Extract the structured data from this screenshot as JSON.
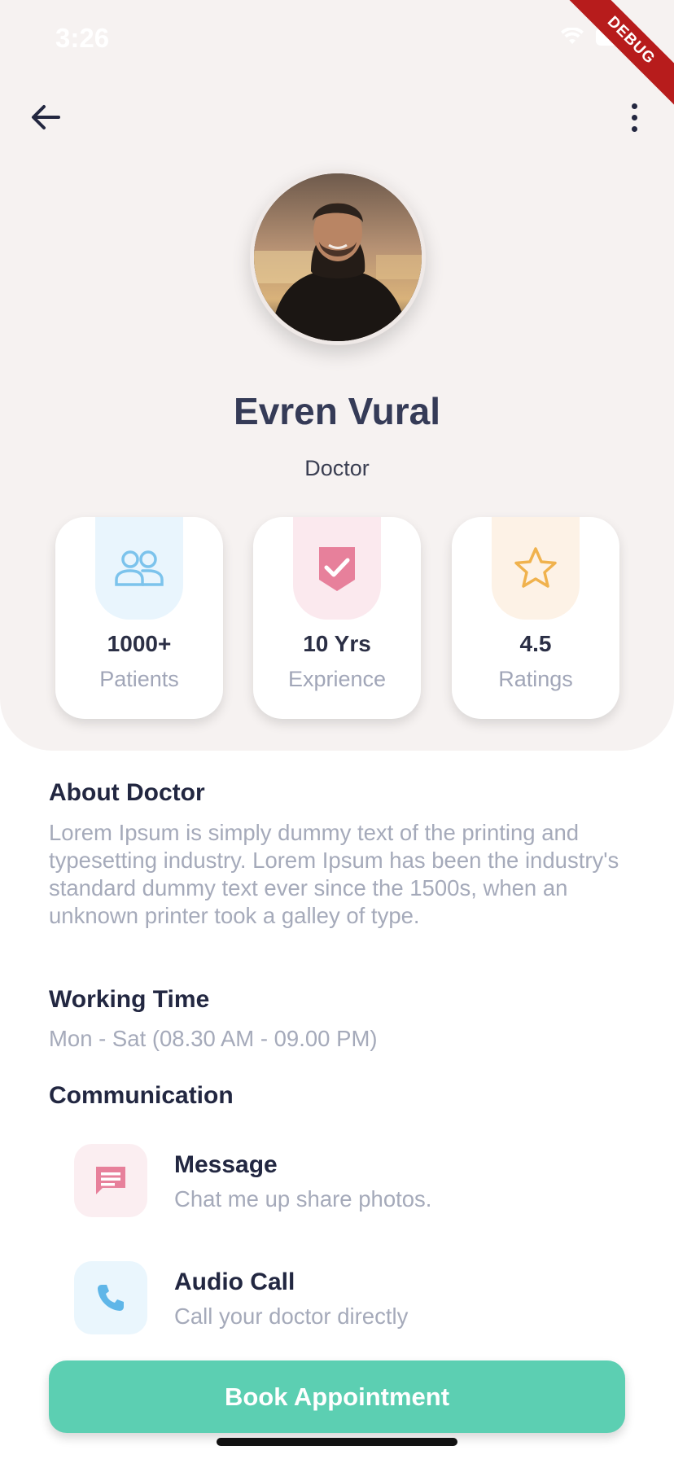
{
  "status_bar": {
    "time": "3:26",
    "debug_label": "DEBUG"
  },
  "toolbar": {
    "back_icon": "arrow-left-icon",
    "menu_icon": "more-vertical-icon"
  },
  "profile": {
    "name": "Evren Vural",
    "role": "Doctor",
    "avatar_icon": "doctor-photo"
  },
  "stats": [
    {
      "value": "1000+",
      "label": "Patients",
      "icon": "people-icon",
      "color": "#7cc3ec",
      "bg": "#e9f5fd"
    },
    {
      "value": "10 Yrs",
      "label": "Exprience",
      "icon": "shield-check-icon",
      "color": "#e7809b",
      "bg": "#fbe9ee"
    },
    {
      "value": "4.5",
      "label": "Ratings",
      "icon": "star-icon",
      "color": "#f0b24d",
      "bg": "#fdf2e6"
    }
  ],
  "about": {
    "title": "About Doctor",
    "text": "Lorem Ipsum is simply dummy text of the printing and typesetting industry. Lorem Ipsum has been the industry's standard dummy text ever since the 1500s, when an unknown printer took a galley of type."
  },
  "working": {
    "title": "Working Time",
    "text": "Mon - Sat (08.30 AM - 09.00 PM)"
  },
  "communication": {
    "title": "Communication",
    "items": [
      {
        "title": "Message",
        "subtitle": "Chat me up share photos.",
        "icon": "message-icon",
        "color": "#e7809b",
        "bg": "#fbeef1"
      },
      {
        "title": "Audio Call",
        "subtitle": "Call your doctor directly",
        "icon": "phone-icon",
        "color": "#5fb6e8",
        "bg": "#eaf6fd"
      }
    ]
  },
  "cta": {
    "label": "Book Appointment",
    "color": "#5ccfb2"
  }
}
